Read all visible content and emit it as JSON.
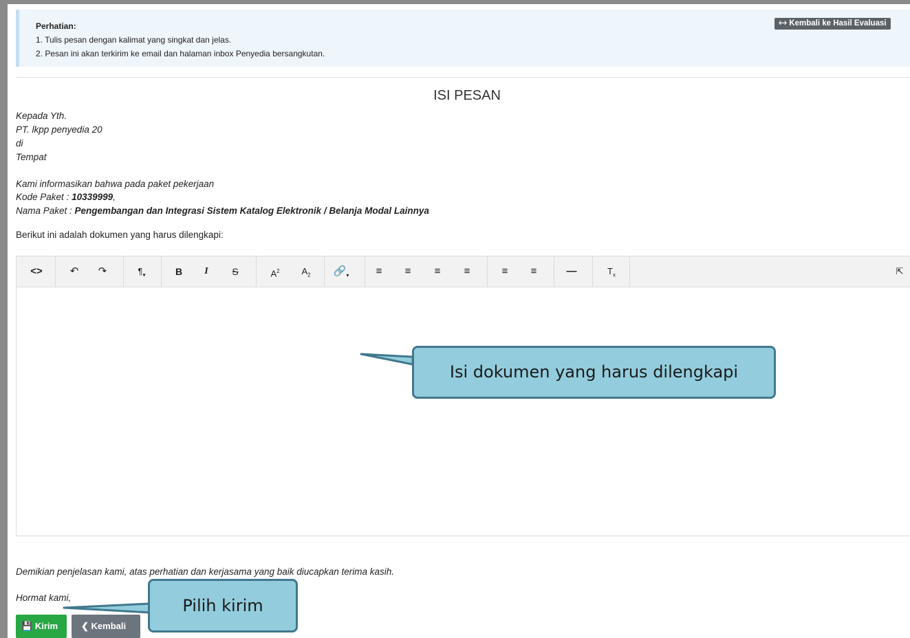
{
  "notice": {
    "title": "Perhatian:",
    "line1": "1. Tulis pesan dengan kalimat yang singkat dan jelas.",
    "line2": "2. Pesan ini akan terkirim ke email dan halaman inbox Penyedia bersangkutan."
  },
  "back_to_evaluation": "Kembali ke Hasil Evaluasi",
  "heading": "ISI PESAN",
  "letter": {
    "to": "Kepada Yth.",
    "company": "PT. lkpp penyedia 20",
    "di": "di",
    "place": "Tempat",
    "intro": "Kami informasikan bahwa pada paket pekerjaan",
    "kode_label": "Kode Paket : ",
    "kode_value": "10339999",
    "kode_suffix": ",",
    "nama_label": "Nama Paket : ",
    "nama_value": "Pengembangan dan Integrasi Sistem Katalog Elektronik / Belanja Modal Lainnya",
    "docs_intro": "Berikut ini adalah dokumen yang harus dilengkapi:",
    "closing": "Demikian penjelasan kami, atas perhatian dan kerjasama yang baik diucapkan terima kasih.",
    "regards": "Hormat kami,"
  },
  "toolbar_icons": [
    "code-view",
    "undo",
    "redo",
    "paragraph-format",
    "bold",
    "italic",
    "strikethrough",
    "superscript",
    "subscript",
    "insert-link",
    "align-left",
    "align-center",
    "align-right",
    "align-justify",
    "unordered-list",
    "ordered-list",
    "horizontal-line",
    "clear-formatting",
    "fullscreen"
  ],
  "callouts": {
    "editor": "Isi dokumen yang harus dilengkapi",
    "send": "Pilih kirim"
  },
  "buttons": {
    "send": "Kirim",
    "back": "Kembali"
  },
  "colors": {
    "send_button": "#28a745",
    "back_button": "#6c757d",
    "callout_fill": "#93cddd",
    "callout_border": "#41788d"
  }
}
